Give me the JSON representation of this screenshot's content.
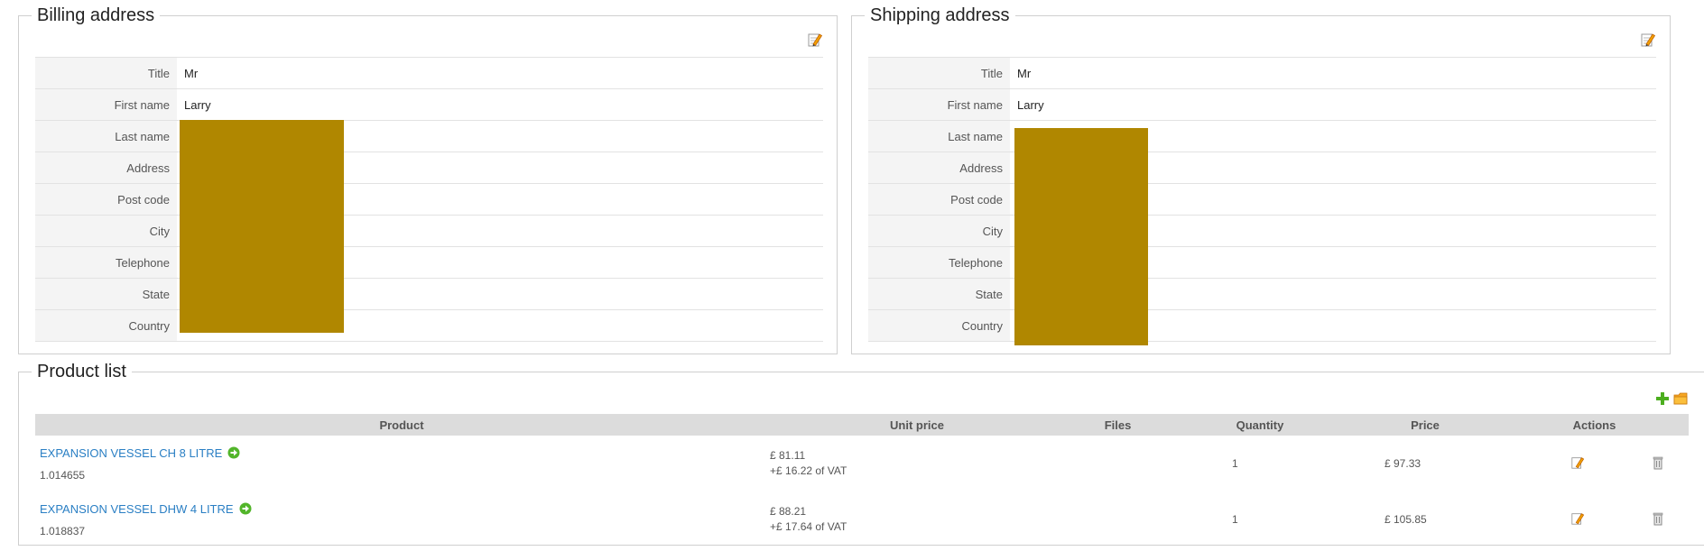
{
  "billing": {
    "legend": "Billing address",
    "rows": [
      {
        "label": "Title",
        "value": "Mr"
      },
      {
        "label": "First name",
        "value": "Larry"
      },
      {
        "label": "Last name",
        "value": ""
      },
      {
        "label": "Address",
        "value": ""
      },
      {
        "label": "Post code",
        "value": ""
      },
      {
        "label": "City",
        "value": ""
      },
      {
        "label": "Telephone",
        "value": ""
      },
      {
        "label": "State",
        "value": ""
      },
      {
        "label": "Country",
        "value": ""
      }
    ],
    "edit_icon": "edit-icon"
  },
  "shipping": {
    "legend": "Shipping address",
    "rows": [
      {
        "label": "Title",
        "value": "Mr"
      },
      {
        "label": "First name",
        "value": "Larry"
      },
      {
        "label": "Last name",
        "value": ""
      },
      {
        "label": "Address",
        "value": ""
      },
      {
        "label": "Post code",
        "value": ""
      },
      {
        "label": "City",
        "value": ""
      },
      {
        "label": "Telephone",
        "value": ""
      },
      {
        "label": "State",
        "value": ""
      },
      {
        "label": "Country",
        "value": ""
      }
    ],
    "edit_icon": "edit-icon"
  },
  "products": {
    "legend": "Product list",
    "toolbar_icons": [
      "add-icon",
      "folder-icon"
    ],
    "columns": [
      "Product",
      "Unit price",
      "Files",
      "Quantity",
      "Price",
      "Actions"
    ],
    "items": [
      {
        "name": "EXPANSION VESSEL CH 8 LITRE",
        "sku": "1.014655",
        "unit_price": "£ 81.11",
        "vat": "+£ 16.22 of VAT",
        "files": "",
        "quantity": "1",
        "price": "£ 97.33"
      },
      {
        "name": "EXPANSION VESSEL DHW 4 LITRE",
        "sku": "1.018837",
        "unit_price": "£ 88.21",
        "vat": "+£ 17.64 of VAT",
        "files": "",
        "quantity": "1",
        "price": "£ 105.85"
      }
    ],
    "row_action_icons": [
      "edit-icon",
      "delete-icon"
    ]
  },
  "colors": {
    "redaction": "#b08700",
    "link": "#2a7fc4",
    "header_bg": "#dcdcdc"
  }
}
